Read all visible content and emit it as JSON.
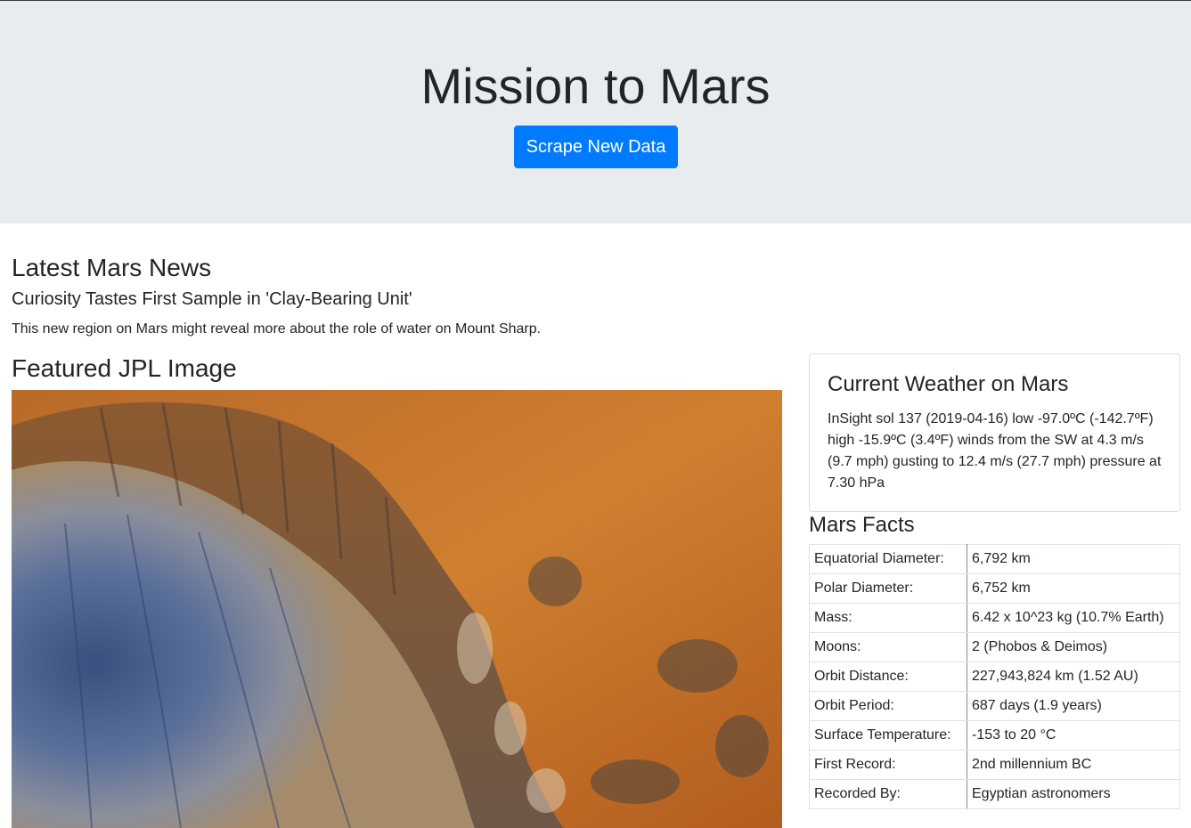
{
  "header": {
    "title": "Mission to Mars",
    "scrape_button": "Scrape New Data"
  },
  "news": {
    "heading": "Latest Mars News",
    "title": "Curiosity Tastes First Sample in 'Clay-Bearing Unit'",
    "paragraph": "This new region on Mars might reveal more about the role of water on Mount Sharp."
  },
  "featured": {
    "heading": "Featured JPL Image"
  },
  "weather": {
    "heading": "Current Weather on Mars",
    "text": "InSight sol 137 (2019-04-16) low -97.0ºC (-142.7ºF) high -15.9ºC (3.4ºF) winds from the SW at 4.3 m/s (9.7 mph) gusting to 12.4 m/s (27.7 mph) pressure at 7.30 hPa"
  },
  "facts": {
    "heading": "Mars Facts",
    "rows": [
      {
        "label": "Equatorial Diameter:",
        "value": "6,792 km"
      },
      {
        "label": "Polar Diameter:",
        "value": "6,752 km"
      },
      {
        "label": "Mass:",
        "value": "6.42 x 10^23 kg (10.7% Earth)"
      },
      {
        "label": "Moons:",
        "value": "2 (Phobos & Deimos)"
      },
      {
        "label": "Orbit Distance:",
        "value": "227,943,824 km (1.52 AU)"
      },
      {
        "label": "Orbit Period:",
        "value": "687 days (1.9 years)"
      },
      {
        "label": "Surface Temperature:",
        "value": "-153 to 20 °C"
      },
      {
        "label": "First Record:",
        "value": "2nd millennium BC"
      },
      {
        "label": "Recorded By:",
        "value": "Egyptian astronomers"
      }
    ]
  }
}
